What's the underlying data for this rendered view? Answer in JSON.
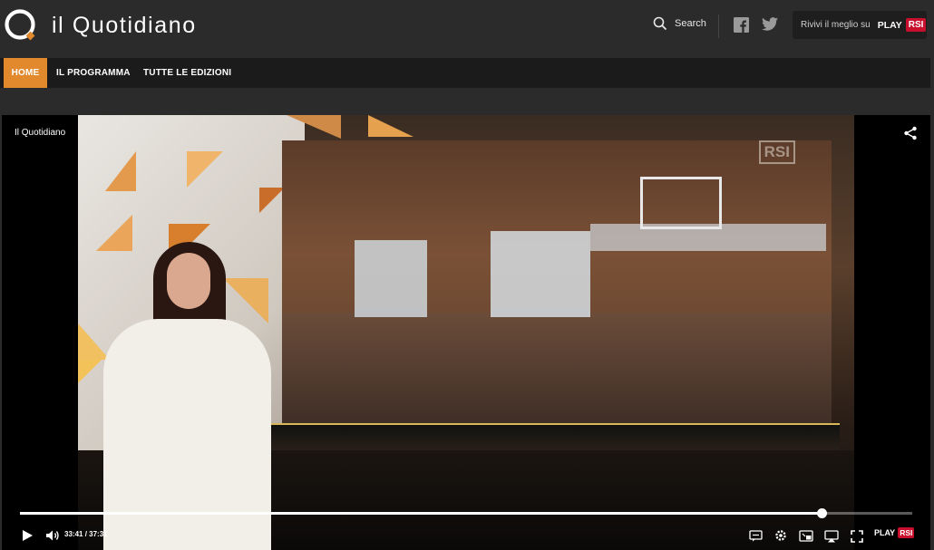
{
  "header": {
    "brand": "il Quotidiano",
    "search_label": "Search",
    "rivivi_label": "Rivivi il meglio su",
    "play_label": "PLAY",
    "rsi_label": "RSI"
  },
  "nav": {
    "items": [
      {
        "label": "HOME",
        "active": true
      },
      {
        "label": "IL PROGRAMMA",
        "active": false
      },
      {
        "label": "TUTTE LE EDIZIONI",
        "active": false
      }
    ]
  },
  "player": {
    "title": "Il Quotidiano",
    "watermark": "RSI",
    "current_time": "33:41",
    "duration": "37:31",
    "time_separator": " / ",
    "progress_fraction": 0.898,
    "play_label": "PLAY",
    "rsi_label": "RSI"
  },
  "colors": {
    "accent": "#e2892e",
    "rsi_red": "#c8102e",
    "background": "#2b2b2b"
  },
  "icons": [
    "logo-icon",
    "search-icon",
    "facebook-icon",
    "twitter-icon",
    "share-icon",
    "play-icon",
    "volume-icon",
    "subtitles-icon",
    "settings-icon",
    "pip-icon",
    "airplay-icon",
    "fullscreen-icon"
  ]
}
